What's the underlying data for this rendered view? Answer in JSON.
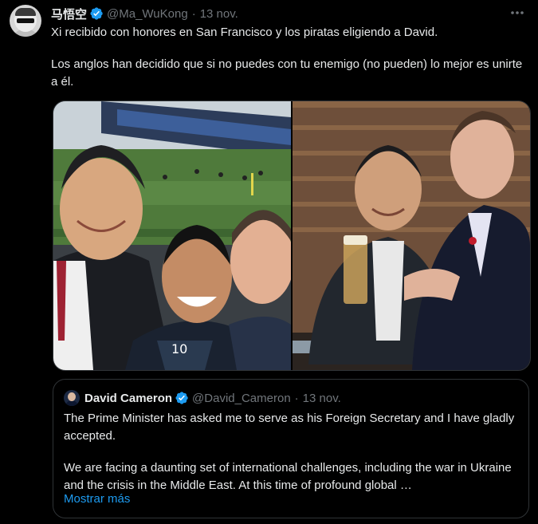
{
  "tweet": {
    "author": {
      "display_name": "马悟空",
      "handle": "@Ma_WuKong",
      "verified": true
    },
    "separator": "·",
    "date": "13 nov.",
    "more_icon": "more-horizontal-icon",
    "paragraphs": [
      "Xi recibido con honores en San Francisco y los piratas eligiendo a David.",
      "Los anglos han decidido que si no puedes con tu enemigo (no pueden) lo mejor es unirte a él."
    ],
    "media": {
      "count": 2,
      "jersey_number": "10"
    }
  },
  "quoted_tweet": {
    "author": {
      "display_name": "David Cameron",
      "handle": "@David_Cameron",
      "verified": true
    },
    "separator": "·",
    "date": "13 nov.",
    "paragraphs": [
      "The Prime Minister has asked me to serve as his Foreign Secretary and I have gladly accepted.",
      "We are facing a daunting set of international challenges, including the war in Ukraine and the crisis in the Middle East. At this time of profound global …"
    ],
    "show_more_label": "Mostrar más"
  },
  "colors": {
    "background": "#000000",
    "text_primary": "#e7e9ea",
    "text_secondary": "#71767b",
    "accent": "#1d9bf0",
    "border": "#2f3336"
  }
}
